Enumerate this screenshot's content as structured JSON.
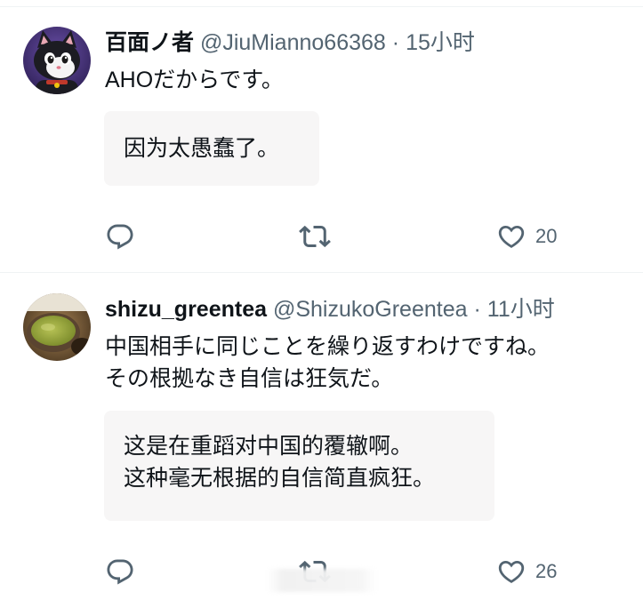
{
  "tweets": [
    {
      "display_name": "百面ノ者",
      "handle": "@JiuMianno66368",
      "separator": "·",
      "time": "15小时",
      "text": "AHOだからです。",
      "translation": "因为太愚蠢了。",
      "reply_count": "",
      "retweet_count": "",
      "like_count": "20",
      "avatar": "cat-character-avatar"
    },
    {
      "display_name": "shizu_greentea",
      "handle": "@ShizukoGreentea",
      "separator": "·",
      "time": "11小时",
      "text": "中国相手に同じことを繰り返すわけですね。\nその根拠なき自信は狂気だ。",
      "translation": "这是在重蹈对中国的覆辙啊。\n这种毫无根据的自信简直疯狂。",
      "reply_count": "",
      "retweet_count": "",
      "like_count": "26",
      "avatar": "green-tea-cup-avatar"
    }
  ],
  "icons": {
    "reply": "reply-bubble-icon",
    "retweet": "retweet-arrows-icon",
    "like": "heart-icon"
  },
  "colors": {
    "text_primary": "#0f1419",
    "text_secondary": "#536471",
    "translation_bg": "#f7f6f6",
    "divider": "#eff3f4"
  }
}
